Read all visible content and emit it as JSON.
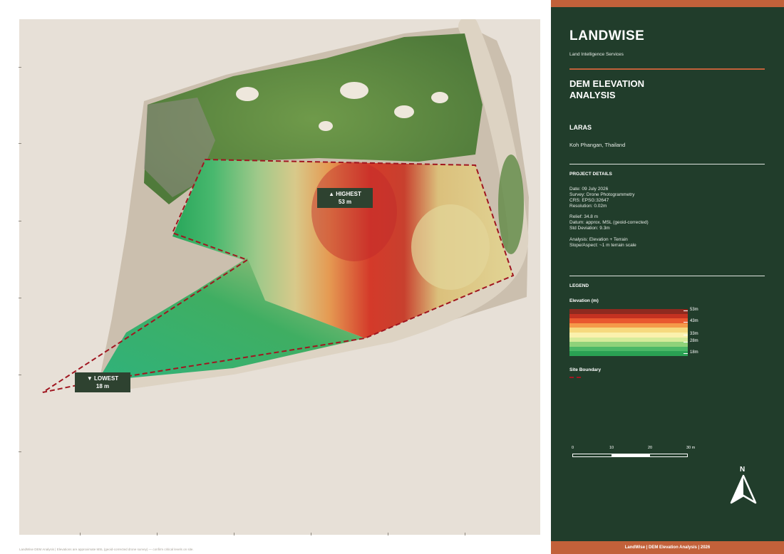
{
  "brand": {
    "name": "LANDWISE",
    "tagline": "Land Intelligence Services"
  },
  "report": {
    "title_line1": "DEM ELEVATION",
    "title_line2": "ANALYSIS"
  },
  "site": {
    "name": "LARAS",
    "location": "Koh Phangan, Thailand"
  },
  "project_details": {
    "heading": "PROJECT DETAILS",
    "date": "Date:  09 July 2026",
    "survey": "Survey:  Drone Photogrammetry",
    "crs": "CRS:  EPSG:32647",
    "resolution": "Resolution:  0.02m",
    "relief": "Relief:  34.8 m",
    "datum": "Datum:  approx. MSL (geoid-corrected)",
    "std_dev": "Std Deviation:  9.3m",
    "analysis": "Analysis:  Elevation + Terrain",
    "slope": "Slope/Aspect:  ~1 m terrain scale"
  },
  "legend": {
    "heading": "LEGEND",
    "elevation_title": "Elevation (m)",
    "labels": [
      "53m",
      "43m",
      "33m",
      "28m",
      "18m"
    ],
    "band_colors": [
      "#8e2a1f",
      "#c43221",
      "#e9582f",
      "#f59a4a",
      "#f6d97e",
      "#fbf1ad",
      "#d6eb9a",
      "#8fd27a",
      "#4cb867",
      "#2aa153"
    ],
    "site_boundary_label": "Site Boundary",
    "site_boundary_color": "#a01620"
  },
  "scale_bar": {
    "labels": [
      "0",
      "10",
      "20",
      "30 m"
    ]
  },
  "north_arrow": {
    "label": "N"
  },
  "map": {
    "highest_label": "▲ HIGHEST",
    "highest_value": "53 m",
    "lowest_label": "▼ LOWEST",
    "lowest_value": "18 m",
    "background_color": "#e7e0d7"
  },
  "footer": {
    "panel_footer": "LandWise  |  DEM Elevation Analysis  |  2026",
    "map_note": "LandWise DEM Analysis  |  Elevations are approximate MSL (geoid-corrected drone survey) — confirm critical levels on site."
  }
}
